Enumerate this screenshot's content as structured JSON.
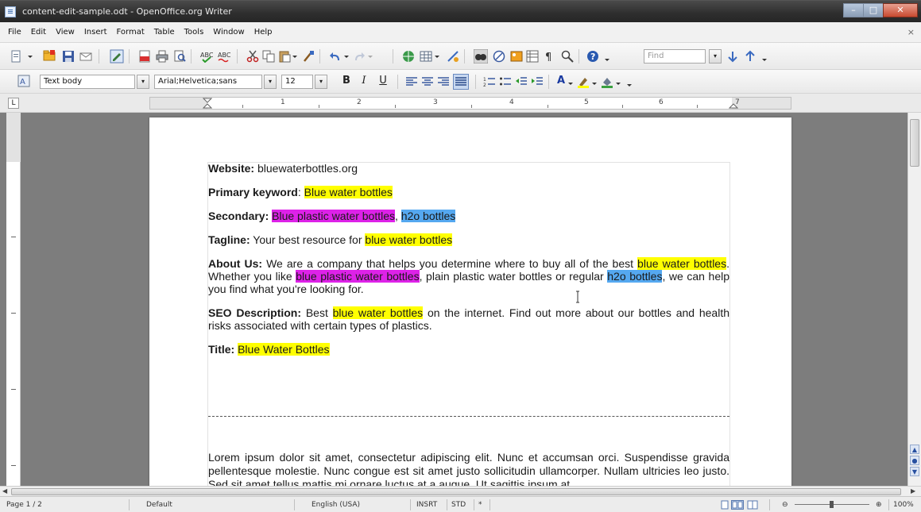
{
  "window": {
    "title": "content-edit-sample.odt - OpenOffice.org Writer",
    "min_glyph": "–",
    "max_glyph": "□",
    "close_glyph": "✕"
  },
  "menu": {
    "items": [
      "File",
      "Edit",
      "View",
      "Insert",
      "Format",
      "Table",
      "Tools",
      "Window",
      "Help"
    ],
    "close_glyph": "×"
  },
  "toolbar": {
    "find_placeholder": "Find"
  },
  "formatting": {
    "style": "Text body",
    "font": "Arial;Helvetica;sans",
    "size": "12",
    "bold": "B",
    "italic": "I",
    "underline": "U",
    "font_color": "A"
  },
  "ruler": {
    "corner": "L",
    "numbers": [
      "1",
      "2",
      "3",
      "4",
      "5",
      "6",
      "7"
    ]
  },
  "document": {
    "website": {
      "label": "Website:",
      "value": " bluewaterbottles.org"
    },
    "primary": {
      "label": "Primary keyword",
      "sep": ": ",
      "keyword": "Blue water bottles"
    },
    "secondary": {
      "label": "Secondary:",
      "kw1": "Blue plastic water bottles",
      "sep": ", ",
      "kw2": "h2o bottles"
    },
    "tagline": {
      "label": "Tagline:",
      "text": " Your best resource for ",
      "keyword": "blue water bottles"
    },
    "about": {
      "label": "About Us:",
      "t1": " We are a company that helps you determine where to buy all of the best ",
      "k1": "blue water bottles",
      "t2": ". Whether you like ",
      "k2": "blue plastic water bottles",
      "t3": ", plain plastic water bottles or regular ",
      "k3": "h2o bottles",
      "t4": ", we can help you find what you're looking for."
    },
    "seo": {
      "label": "SEO Description:",
      "t1": " Best ",
      "k1": "blue water bottles",
      "t2": " on the internet. Find out more about our bottles and health risks associated with certain types of plastics."
    },
    "title": {
      "label": "Title:",
      "value": "Blue Water Bottles"
    },
    "lorem": "Lorem ipsum dolor sit amet, consectetur adipiscing elit. Nunc et accumsan orci. Suspendisse gravida pellentesque molestie. Nunc congue est sit amet justo sollicitudin ullamcorper. Nullam ultricies leo justo. Sed sit amet tellus mattis mi ornare luctus at a augue. Ut sagittis ipsum at"
  },
  "status": {
    "page": "Page 1 / 2",
    "style": "Default",
    "language": "English (USA)",
    "insert": "INSRT",
    "selection": "STD",
    "modified": "*",
    "zoom": "100%",
    "zoom_minus": "⊖",
    "zoom_plus": "⊕"
  },
  "colors": {
    "highlight_yellow": "#ffff00",
    "highlight_magenta": "#dd22e8",
    "highlight_blue": "#55a8f0"
  }
}
